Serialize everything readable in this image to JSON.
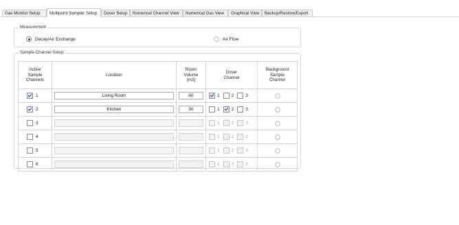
{
  "tabs": [
    {
      "label": "Gas Monitor Setup",
      "active": false
    },
    {
      "label": "Multipoint Sampler Setup",
      "active": true
    },
    {
      "label": "Doser Setup",
      "active": false
    },
    {
      "label": "Numerical Channel View",
      "active": false
    },
    {
      "label": "Numerical Gas View",
      "active": false
    },
    {
      "label": "Graphical View",
      "active": false
    },
    {
      "label": "Backup/Restore/Export",
      "active": false
    }
  ],
  "measurement": {
    "title": "Measurement",
    "options": [
      {
        "label": "Decay/Air Exchange",
        "selected": true
      },
      {
        "label": "Air Flow",
        "selected": false
      }
    ]
  },
  "sample_setup": {
    "title": "Sample Channel Setup",
    "headers": {
      "active": "Active Sample Channels",
      "location": "Location",
      "volume": "Room Volume [m3]",
      "doser": "Doser Channel",
      "background": "Background Sample Channel"
    },
    "doser_labels": [
      "1",
      "2",
      "3"
    ],
    "rows": [
      {
        "channel": "1",
        "active": true,
        "location": "Living Room",
        "volume": "60",
        "doser": [
          true,
          false,
          false
        ]
      },
      {
        "channel": "2",
        "active": true,
        "location": "Kitchen",
        "volume": "30",
        "doser": [
          false,
          true,
          false
        ]
      },
      {
        "channel": "3",
        "active": false,
        "location": "",
        "volume": "",
        "doser": [
          false,
          false,
          false
        ]
      },
      {
        "channel": "4",
        "active": false,
        "location": "",
        "volume": "",
        "doser": [
          false,
          false,
          false
        ]
      },
      {
        "channel": "5",
        "active": false,
        "location": "",
        "volume": "",
        "doser": [
          false,
          false,
          false
        ]
      },
      {
        "channel": "6",
        "active": false,
        "location": "",
        "volume": "",
        "doser": [
          false,
          false,
          false
        ]
      }
    ]
  }
}
